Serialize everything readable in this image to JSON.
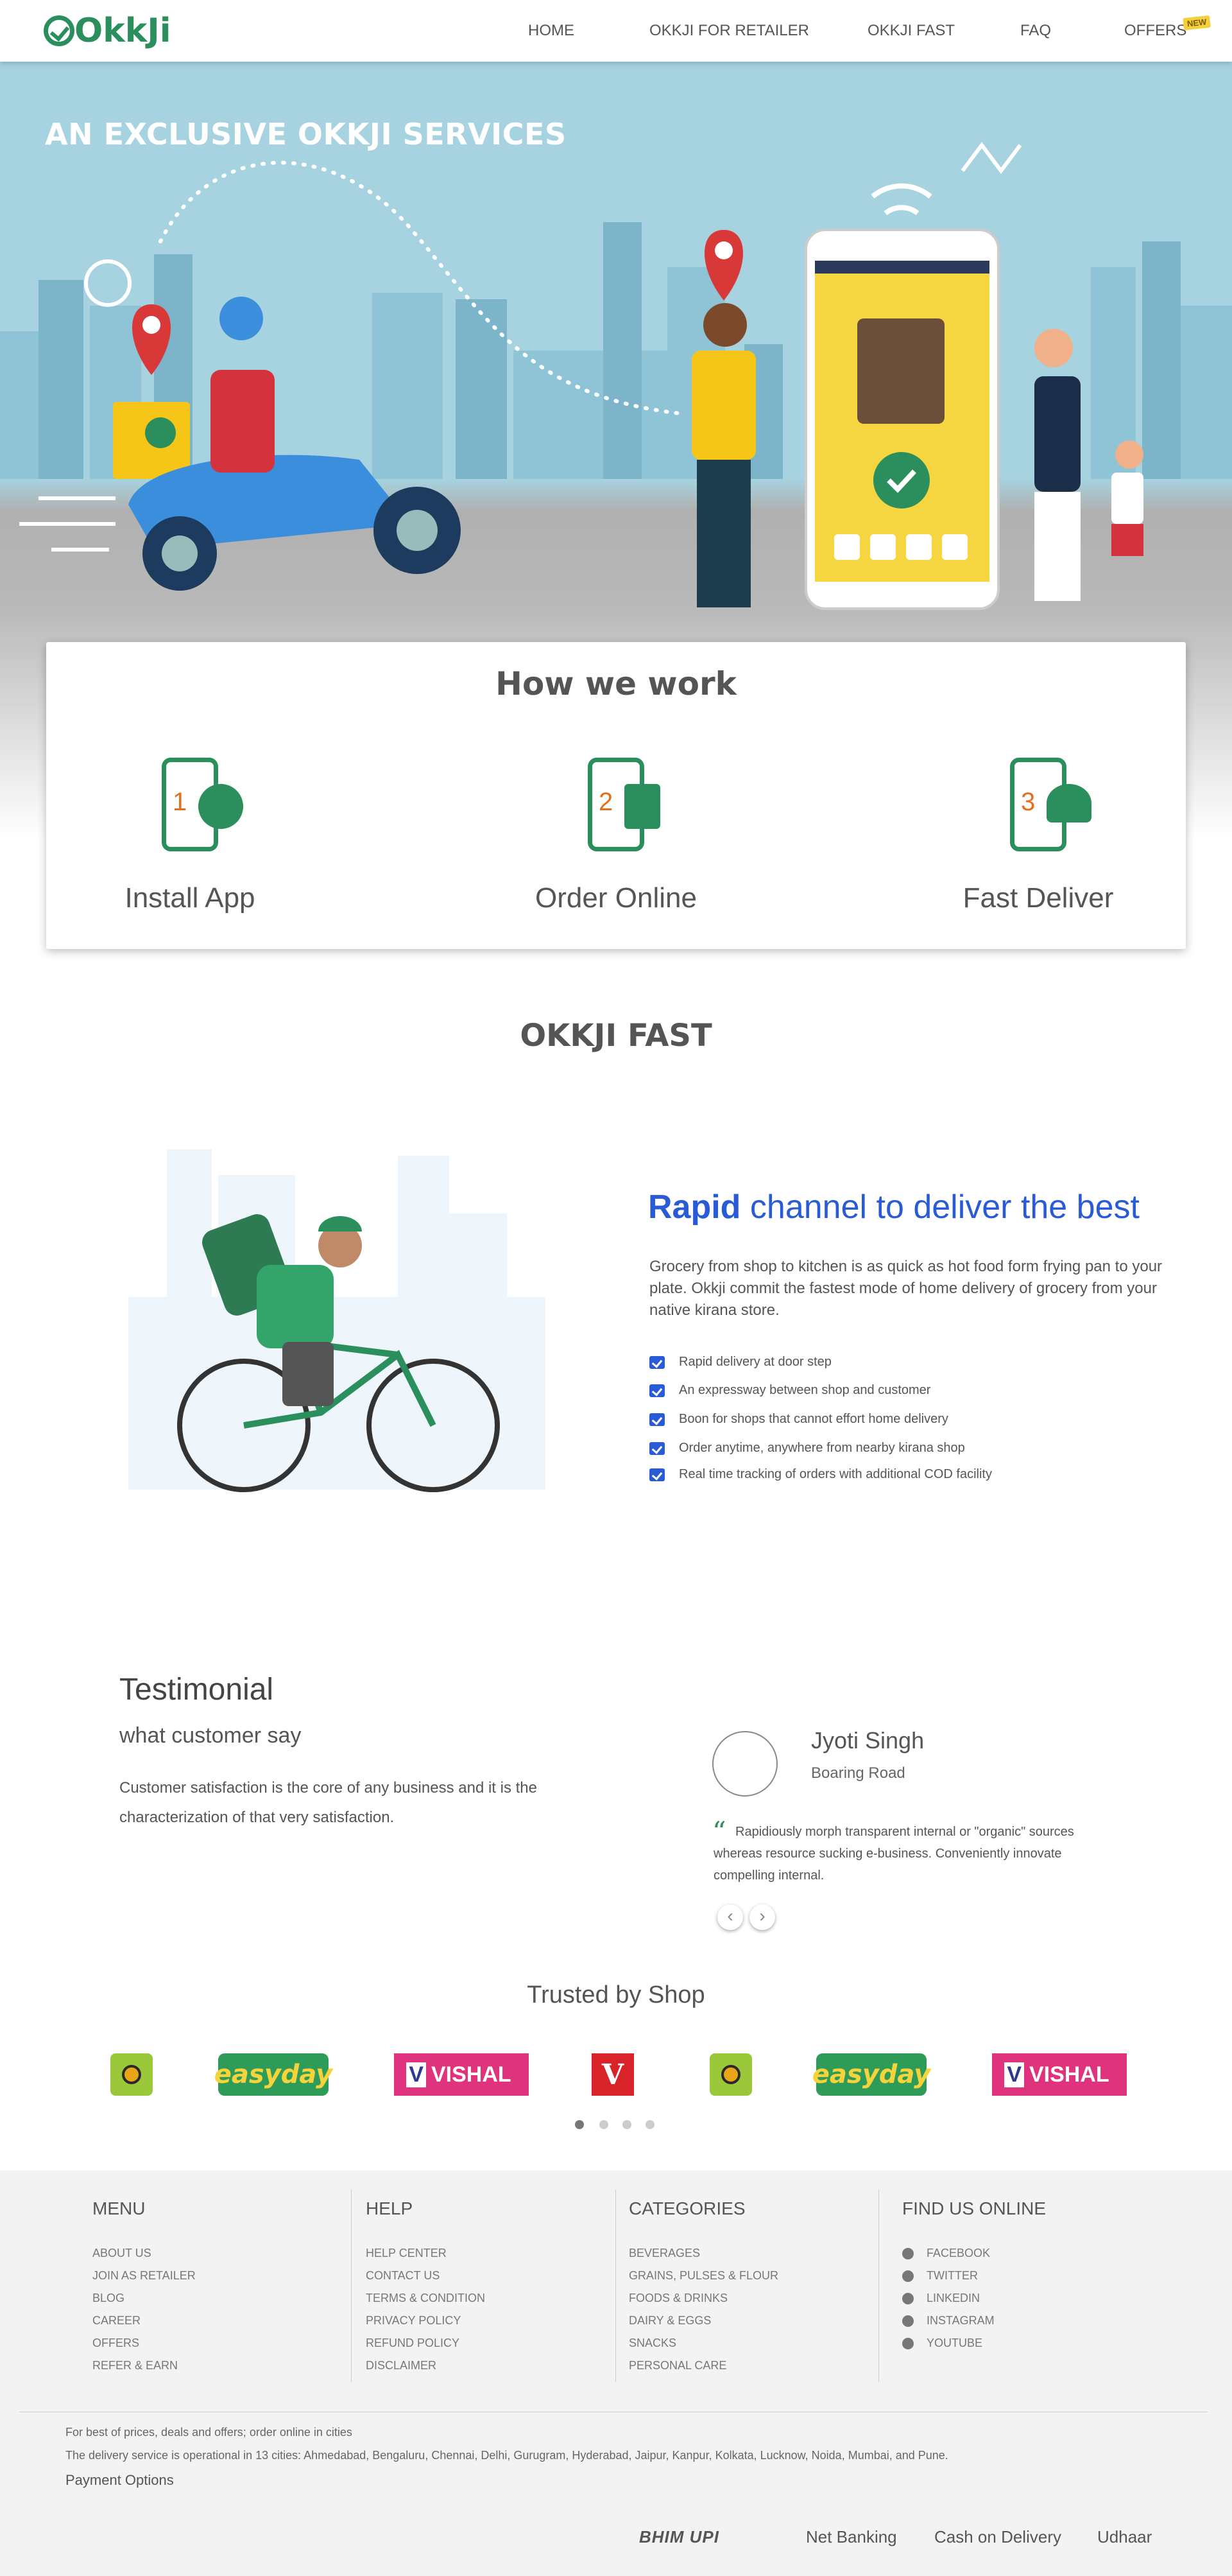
{
  "nav": {
    "logo": "OkkJi",
    "items": [
      "HOME",
      "OKKJI FOR RETAILER",
      "OKKJI FAST",
      "FAQ",
      "OFFERS"
    ],
    "offers_badge": "NEW"
  },
  "hero": {
    "title": "AN EXCLUSIVE OKKJI SERVICES"
  },
  "how_we_work": {
    "title": "How we work",
    "steps": [
      {
        "num": "1",
        "label": "Install App",
        "icon": "gear-icon"
      },
      {
        "num": "2",
        "label": "Order Online",
        "icon": "shopping-bag-icon"
      },
      {
        "num": "3",
        "label": "Fast Deliver",
        "icon": "helmet-icon"
      }
    ]
  },
  "okkji_fast": {
    "title": "OKKJI FAST",
    "headline_bold": "Rapid",
    "headline_rest": " channel to deliver the best",
    "description": "Grocery from shop to kitchen is as quick as hot food form frying pan to your plate. Okkji commit the fastest mode of home delivery of grocery from your native kirana store.",
    "features": [
      "Rapid delivery at door step",
      "An expressway between shop and customer",
      "Boon for shops that cannot effort home delivery",
      "Order anytime, anywhere from nearby kirana shop",
      "Real time tracking of orders with additional COD facility"
    ]
  },
  "testimonial": {
    "title": "Testimonial",
    "subtitle": "what customer say",
    "description": "Customer satisfaction is the core of any business and it is the characterization of that very satisfaction.",
    "reviewer_name": "Jyoti Singh",
    "reviewer_location": "Boaring Road",
    "quote": "Rapidiously morph transparent internal or \"organic\" sources whereas resource sucking e-business. Conveniently innovate compelling internal.",
    "prev": "‹",
    "next": "›"
  },
  "trusted": {
    "title": "Trusted by Shop",
    "easyday": "easyday",
    "vishal_v": "V",
    "vishal": "VISHAL",
    "vmart": "V"
  },
  "footer": {
    "menu": {
      "title": "MENU",
      "links": [
        "ABOUT US",
        "JOIN AS RETAILER",
        "BLOG",
        "CAREER",
        "OFFERS",
        "REFER & EARN"
      ]
    },
    "help": {
      "title": "HELP",
      "links": [
        "HELP CENTER",
        "CONTACT US",
        "TERMS & CONDITION",
        "PRIVACY POLICY",
        "REFUND POLICY",
        "DISCLAIMER"
      ]
    },
    "categories": {
      "title": "CATEGORIES",
      "links": [
        "BEVERAGES",
        "GRAINS, PULSES & FLOUR",
        "FOODS & DRINKS",
        "DAIRY & EGGS",
        "SNACKS",
        "PERSONAL CARE"
      ]
    },
    "social": {
      "title": "FIND US ONLINE",
      "links": [
        "FACEBOOK",
        "TWITTER",
        "LINKEDIN",
        "INSTAGRAM",
        "YOUTUBE"
      ]
    },
    "note1": "For best of prices, deals and offers; order online in cities",
    "note2": "The delivery service is operational in 13 cities: Ahmedabad, Bengaluru, Chennai, Delhi, Gurugram, Hyderabad, Jaipur, Kanpur, Kolkata, Lucknow, Noida, Mumbai, and Pune.",
    "payment_title": "Payment Options",
    "payments": [
      "BHIM UPI",
      "Net Banking",
      "Cash on Delivery",
      "Udhaar"
    ]
  },
  "colors": {
    "brand_green": "#2a8f5c",
    "accent_blue": "#2a5bd7",
    "step_orange": "#e3701e"
  }
}
